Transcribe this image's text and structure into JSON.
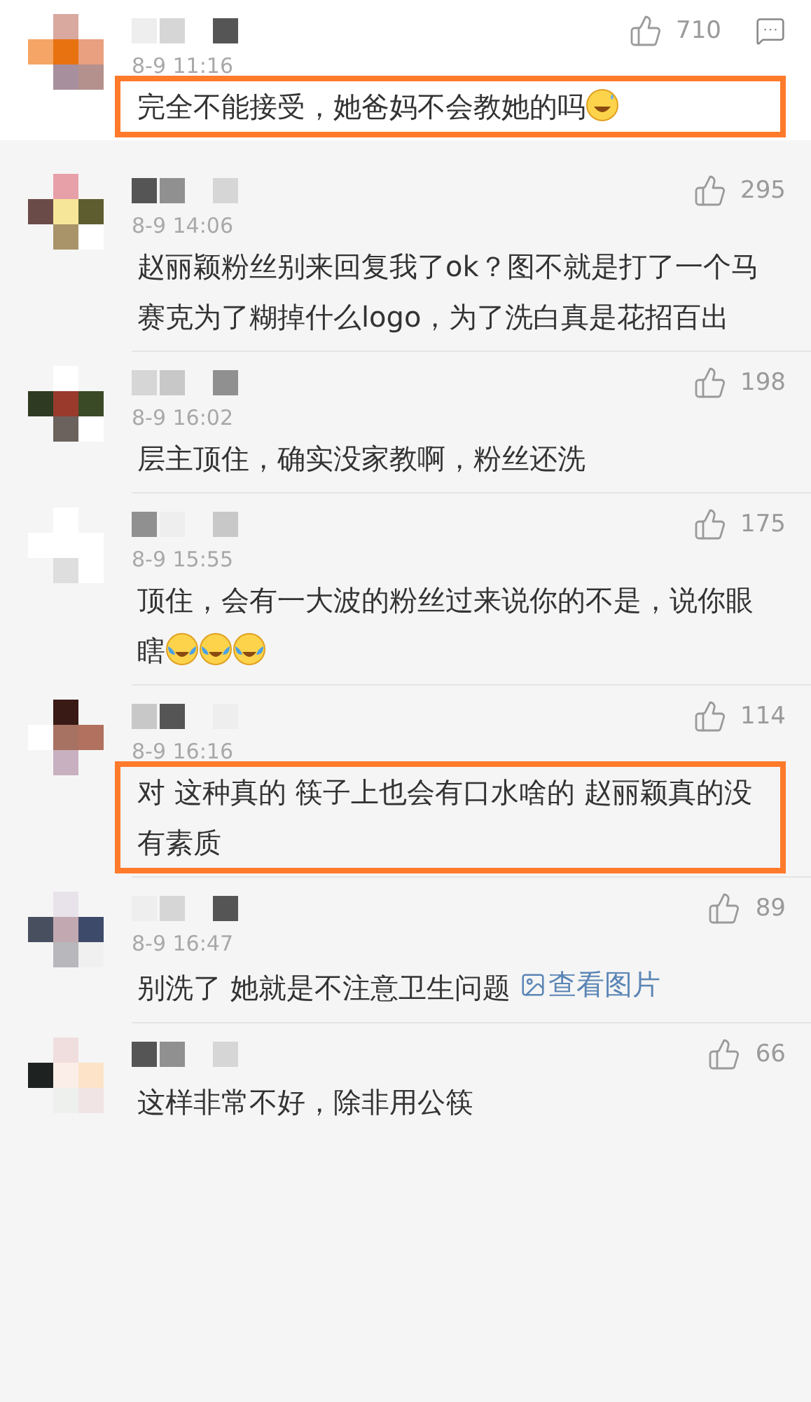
{
  "comments": [
    {
      "time": "8-9 11:16",
      "likes": "710",
      "reply_button": true,
      "highlighted": true,
      "segments": [
        {
          "kind": "text",
          "text": "完全不能接受，她爸妈不会教她的吗"
        },
        {
          "kind": "sweat-emoji"
        }
      ]
    },
    {
      "time": "8-9 14:06",
      "likes": "295",
      "reply_button": false,
      "highlighted": false,
      "segments": [
        {
          "kind": "text",
          "text": "赵丽颖粉丝别来回复我了ok？图不就是打了一个马赛克为了糊掉什么logo，为了洗白真是花招百出"
        }
      ]
    },
    {
      "time": "8-9 16:02",
      "likes": "198",
      "reply_button": false,
      "highlighted": false,
      "segments": [
        {
          "kind": "text",
          "text": "层主顶住，确实没家教啊，粉丝还洗"
        }
      ]
    },
    {
      "time": "8-9 15:55",
      "likes": "175",
      "reply_button": false,
      "highlighted": false,
      "segments": [
        {
          "kind": "text",
          "text": "顶住，会有一大波的粉丝过来说你的不是，说你眼瞎"
        },
        {
          "kind": "cry-emoji"
        },
        {
          "kind": "cry-emoji"
        },
        {
          "kind": "cry-emoji"
        }
      ]
    },
    {
      "time": "8-9 16:16",
      "likes": "114",
      "reply_button": false,
      "highlighted": true,
      "segments": [
        {
          "kind": "text",
          "text": "对 这种真的 筷子上也会有口水啥的 赵丽颖真的没有素质"
        }
      ]
    },
    {
      "time": "8-9 16:47",
      "likes": "89",
      "reply_button": false,
      "highlighted": false,
      "segments": [
        {
          "kind": "text",
          "text": "别洗了 她就是不注意卫生问题 "
        },
        {
          "kind": "link",
          "text": "查看图片"
        }
      ]
    },
    {
      "likes": "66",
      "reply_button": false,
      "highlighted": false,
      "segments": [
        {
          "kind": "text",
          "text": "这样非常不好，除非用公筷"
        }
      ]
    }
  ]
}
